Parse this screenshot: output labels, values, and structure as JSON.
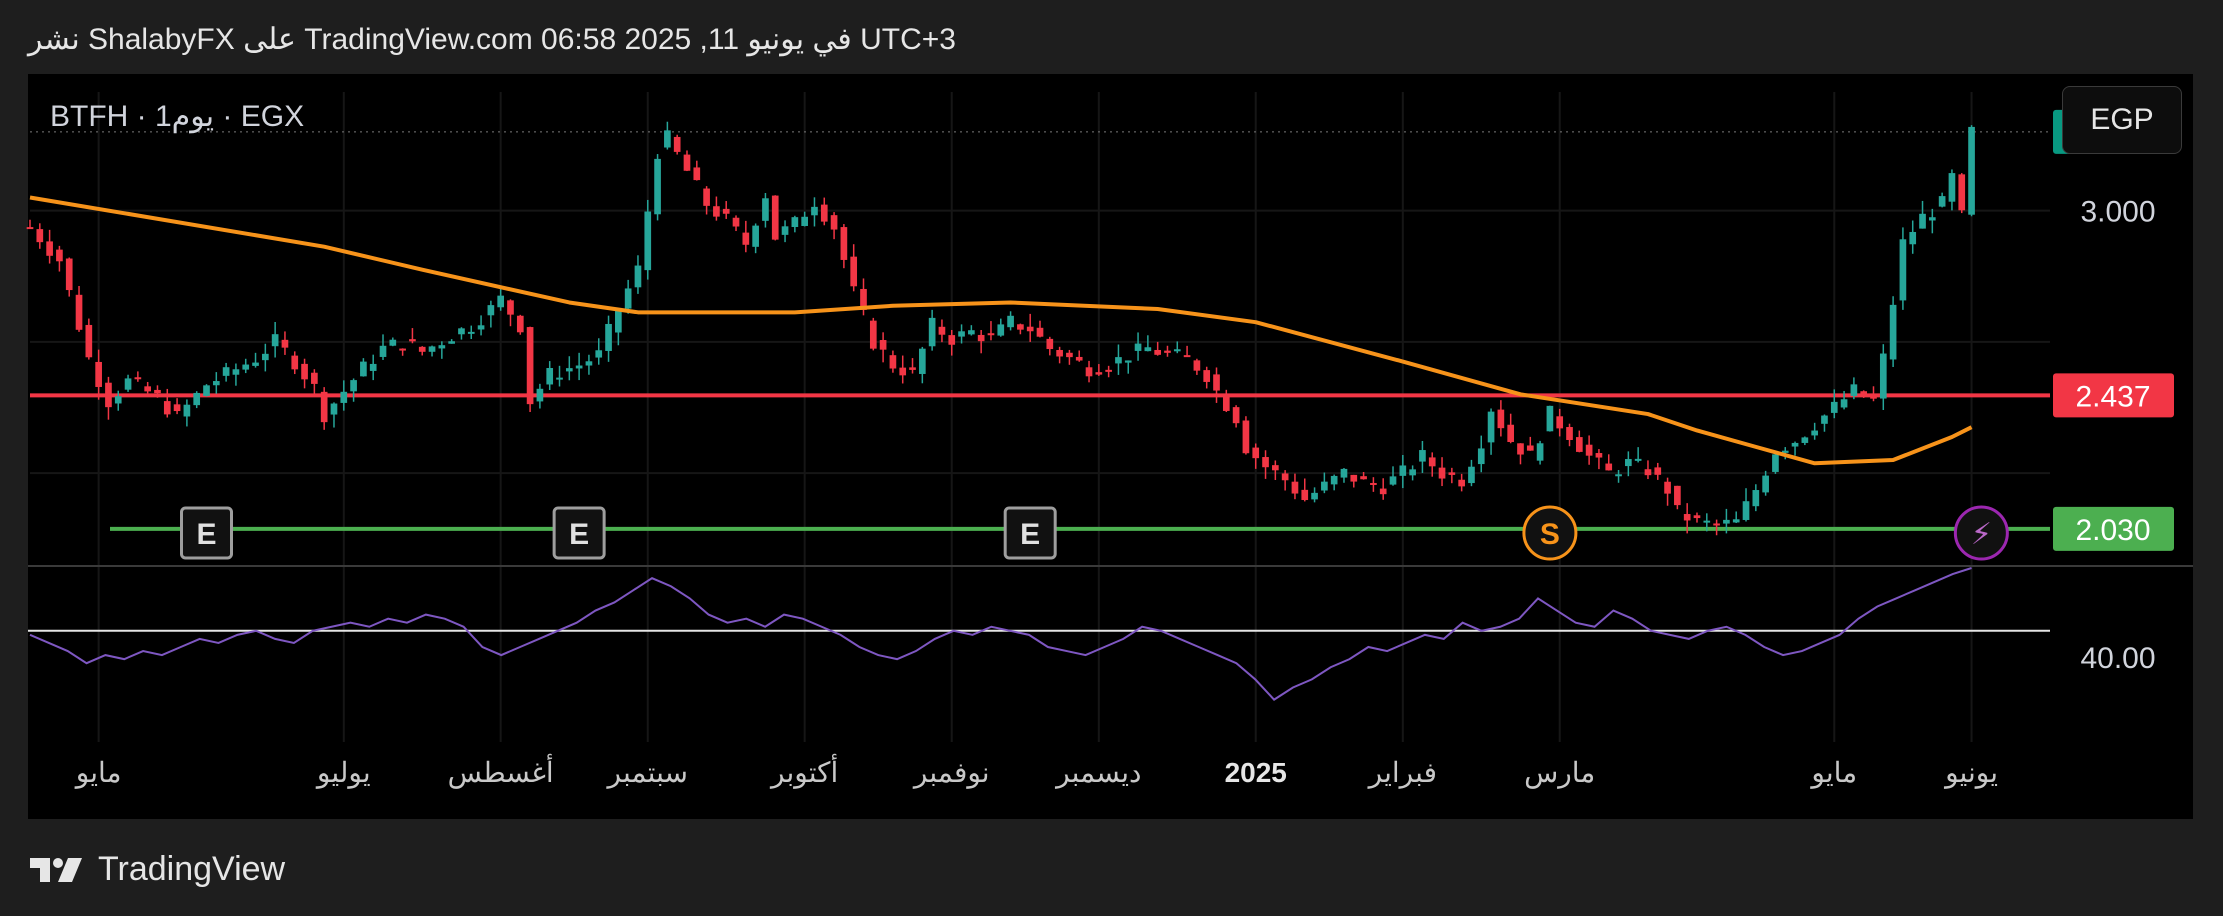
{
  "caption": "نشر ShalabyFX على TradingView.com 06:58 2025 ,11 في يونيو UTC+3",
  "symbol_label": "BTFH · 1يوم · EGX",
  "currency": "EGP",
  "brand": "TradingView",
  "colors": {
    "up": "#26a69a",
    "down": "#f23645",
    "ma": "#f7931a",
    "rsi": "#7e57c2",
    "resistance": "#f23645",
    "support": "#4caf50",
    "last_price_badge": "#089981"
  },
  "chart_data": {
    "type": "line",
    "series": [
      {
        "x": 0,
        "y": 2.95
      },
      {
        "x": 3,
        "y": 2.85
      },
      {
        "x": 6,
        "y": 2.55
      },
      {
        "x": 8,
        "y": 2.42
      },
      {
        "x": 10,
        "y": 2.48
      },
      {
        "x": 13,
        "y": 2.43
      },
      {
        "x": 15,
        "y": 2.37
      },
      {
        "x": 18,
        "y": 2.47
      },
      {
        "x": 20,
        "y": 2.5
      },
      {
        "x": 23,
        "y": 2.55
      },
      {
        "x": 25,
        "y": 2.6
      },
      {
        "x": 27,
        "y": 2.54
      },
      {
        "x": 29,
        "y": 2.46
      },
      {
        "x": 30,
        "y": 2.38
      },
      {
        "x": 32,
        "y": 2.45
      },
      {
        "x": 34,
        "y": 2.52
      },
      {
        "x": 36,
        "y": 2.58
      },
      {
        "x": 38,
        "y": 2.6
      },
      {
        "x": 40,
        "y": 2.57
      },
      {
        "x": 43,
        "y": 2.62
      },
      {
        "x": 45,
        "y": 2.65
      },
      {
        "x": 47,
        "y": 2.7
      },
      {
        "x": 48,
        "y": 2.73
      },
      {
        "x": 50,
        "y": 2.65
      },
      {
        "x": 51,
        "y": 2.42
      },
      {
        "x": 53,
        "y": 2.5
      },
      {
        "x": 56,
        "y": 2.53
      },
      {
        "x": 58,
        "y": 2.56
      },
      {
        "x": 60,
        "y": 2.7
      },
      {
        "x": 62,
        "y": 2.82
      },
      {
        "x": 63,
        "y": 3.0
      },
      {
        "x": 64,
        "y": 3.18
      },
      {
        "x": 65,
        "y": 3.22
      },
      {
        "x": 67,
        "y": 3.12
      },
      {
        "x": 69,
        "y": 3.02
      },
      {
        "x": 71,
        "y": 2.97
      },
      {
        "x": 73,
        "y": 2.9
      },
      {
        "x": 75,
        "y": 3.05
      },
      {
        "x": 76,
        "y": 2.92
      },
      {
        "x": 78,
        "y": 2.96
      },
      {
        "x": 80,
        "y": 3.03
      },
      {
        "x": 82,
        "y": 2.95
      },
      {
        "x": 84,
        "y": 2.75
      },
      {
        "x": 86,
        "y": 2.6
      },
      {
        "x": 88,
        "y": 2.53
      },
      {
        "x": 90,
        "y": 2.5
      },
      {
        "x": 92,
        "y": 2.65
      },
      {
        "x": 94,
        "y": 2.61
      },
      {
        "x": 96,
        "y": 2.63
      },
      {
        "x": 98,
        "y": 2.61
      },
      {
        "x": 100,
        "y": 2.66
      },
      {
        "x": 102,
        "y": 2.64
      },
      {
        "x": 104,
        "y": 2.58
      },
      {
        "x": 106,
        "y": 2.55
      },
      {
        "x": 108,
        "y": 2.52
      },
      {
        "x": 110,
        "y": 2.53
      },
      {
        "x": 112,
        "y": 2.56
      },
      {
        "x": 114,
        "y": 2.58
      },
      {
        "x": 116,
        "y": 2.56
      },
      {
        "x": 118,
        "y": 2.55
      },
      {
        "x": 120,
        "y": 2.5
      },
      {
        "x": 121,
        "y": 2.45
      },
      {
        "x": 123,
        "y": 2.37
      },
      {
        "x": 124,
        "y": 2.28
      },
      {
        "x": 126,
        "y": 2.22
      },
      {
        "x": 128,
        "y": 2.18
      },
      {
        "x": 130,
        "y": 2.12
      },
      {
        "x": 132,
        "y": 2.16
      },
      {
        "x": 134,
        "y": 2.2
      },
      {
        "x": 136,
        "y": 2.17
      },
      {
        "x": 138,
        "y": 2.16
      },
      {
        "x": 140,
        "y": 2.2
      },
      {
        "x": 142,
        "y": 2.25
      },
      {
        "x": 144,
        "y": 2.2
      },
      {
        "x": 146,
        "y": 2.18
      },
      {
        "x": 148,
        "y": 2.3
      },
      {
        "x": 149,
        "y": 2.4
      },
      {
        "x": 151,
        "y": 2.3
      },
      {
        "x": 153,
        "y": 2.25
      },
      {
        "x": 155,
        "y": 2.38
      },
      {
        "x": 157,
        "y": 2.32
      },
      {
        "x": 159,
        "y": 2.25
      },
      {
        "x": 161,
        "y": 2.2
      },
      {
        "x": 163,
        "y": 2.23
      },
      {
        "x": 165,
        "y": 2.21
      },
      {
        "x": 167,
        "y": 2.15
      },
      {
        "x": 168,
        "y": 2.08
      },
      {
        "x": 170,
        "y": 2.05
      },
      {
        "x": 172,
        "y": 2.04
      },
      {
        "x": 174,
        "y": 2.05
      },
      {
        "x": 176,
        "y": 2.15
      },
      {
        "x": 178,
        "y": 2.27
      },
      {
        "x": 180,
        "y": 2.3
      },
      {
        "x": 182,
        "y": 2.35
      },
      {
        "x": 184,
        "y": 2.4
      },
      {
        "x": 186,
        "y": 2.45
      },
      {
        "x": 188,
        "y": 2.42
      },
      {
        "x": 189,
        "y": 2.55
      },
      {
        "x": 190,
        "y": 2.72
      },
      {
        "x": 191,
        "y": 2.9
      },
      {
        "x": 193,
        "y": 2.98
      },
      {
        "x": 195,
        "y": 3.02
      },
      {
        "x": 196,
        "y": 3.1
      },
      {
        "x": 197,
        "y": 2.98
      },
      {
        "x": 198,
        "y": 3.24
      }
    ],
    "ma_series": [
      {
        "x": 0,
        "y": 3.04
      },
      {
        "x": 30,
        "y": 2.89
      },
      {
        "x": 40,
        "y": 2.82
      },
      {
        "x": 55,
        "y": 2.72
      },
      {
        "x": 62,
        "y": 2.69
      },
      {
        "x": 78,
        "y": 2.69
      },
      {
        "x": 88,
        "y": 2.71
      },
      {
        "x": 100,
        "y": 2.72
      },
      {
        "x": 115,
        "y": 2.7
      },
      {
        "x": 125,
        "y": 2.66
      },
      {
        "x": 140,
        "y": 2.54
      },
      {
        "x": 152,
        "y": 2.44
      },
      {
        "x": 165,
        "y": 2.38
      },
      {
        "x": 170,
        "y": 2.33
      },
      {
        "x": 176,
        "y": 2.28
      },
      {
        "x": 182,
        "y": 2.23
      },
      {
        "x": 190,
        "y": 2.24
      },
      {
        "x": 196,
        "y": 2.31
      },
      {
        "x": 198,
        "y": 2.34
      }
    ],
    "y_ticks": [
      "3.000"
    ],
    "resistance": 2.437,
    "resistance_label": "2.437",
    "support": 2.03,
    "support_label": "2.030",
    "last_price": "3.240",
    "ylim": [
      1.92,
      3.27
    ],
    "rsi": {
      "tick_label": "40.00",
      "level": 50,
      "ylim": [
        26,
        66
      ],
      "values": [
        49,
        47,
        45,
        42,
        44,
        43,
        45,
        44,
        46,
        48,
        47,
        49,
        50,
        48,
        47,
        50,
        51,
        52,
        51,
        53,
        52,
        54,
        53,
        51,
        46,
        44,
        46,
        48,
        50,
        52,
        55,
        57,
        60,
        63,
        61,
        58,
        54,
        52,
        53,
        51,
        54,
        53,
        51,
        49,
        46,
        44,
        43,
        45,
        48,
        50,
        49,
        51,
        50,
        49,
        46,
        45,
        44,
        46,
        48,
        51,
        50,
        48,
        46,
        44,
        42,
        38,
        33,
        36,
        38,
        41,
        43,
        46,
        45,
        47,
        49,
        48,
        52,
        50,
        51,
        53,
        58,
        55,
        52,
        51,
        55,
        53,
        50,
        49,
        48,
        50,
        51,
        49,
        46,
        44,
        45,
        47,
        49,
        53,
        56,
        58,
        60,
        62,
        64,
        68
      ]
    },
    "event_markers": [
      {
        "label": "E",
        "x": 18
      },
      {
        "label": "E",
        "x": 56
      },
      {
        "label": "E",
        "x": 102
      },
      {
        "label": "S",
        "x": 155
      },
      {
        "label": "⚡",
        "x": 199
      }
    ],
    "x_labels": [
      {
        "label": "مايو",
        "x": 7,
        "bold": false
      },
      {
        "label": "يوليو",
        "x": 32,
        "bold": false
      },
      {
        "label": "أغسطس",
        "x": 48,
        "bold": false
      },
      {
        "label": "سبتمبر",
        "x": 63,
        "bold": false
      },
      {
        "label": "أكتوبر",
        "x": 79,
        "bold": false
      },
      {
        "label": "نوفمبر",
        "x": 94,
        "bold": false
      },
      {
        "label": "ديسمبر",
        "x": 109,
        "bold": false
      },
      {
        "label": "2025",
        "x": 125,
        "bold": true
      },
      {
        "label": "فبراير",
        "x": 140,
        "bold": false
      },
      {
        "label": "مارس",
        "x": 156,
        "bold": false
      },
      {
        "label": "مايو",
        "x": 184,
        "bold": false
      },
      {
        "label": "يونيو",
        "x": 198,
        "bold": false
      }
    ]
  }
}
